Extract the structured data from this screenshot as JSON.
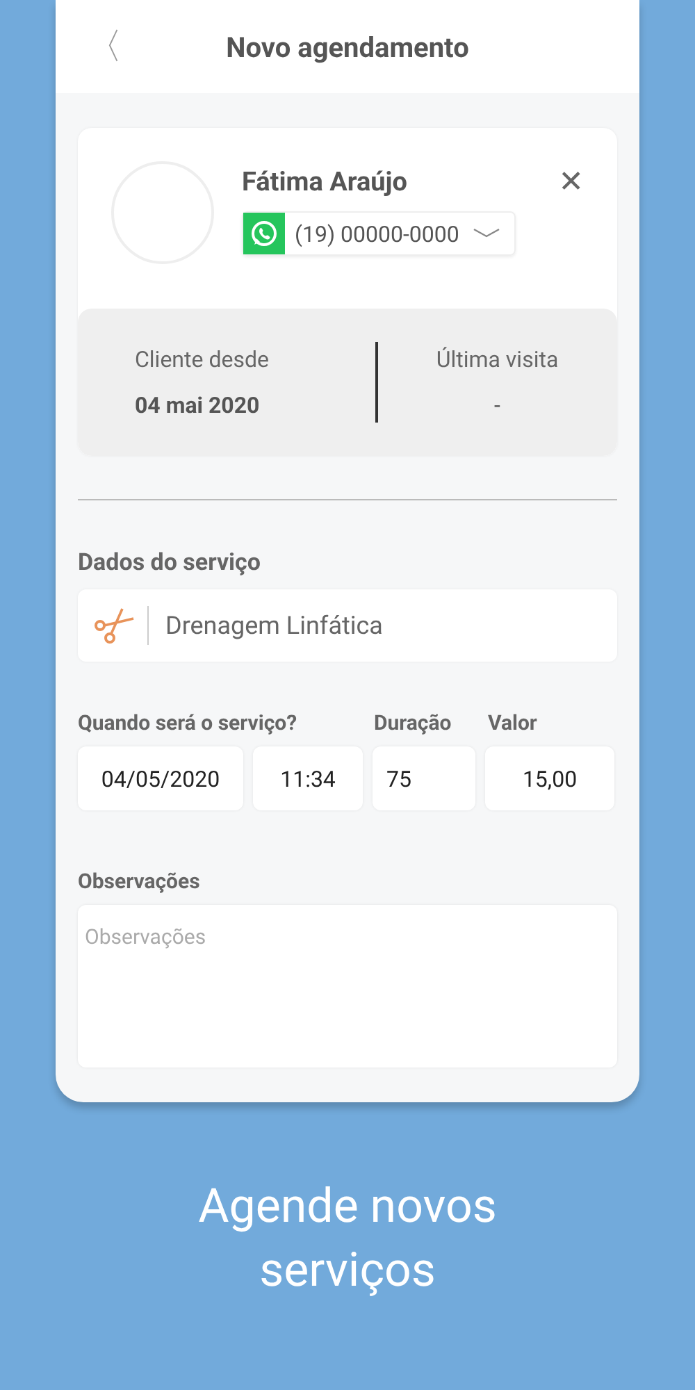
{
  "header": {
    "back": "〈",
    "title": "Novo agendamento"
  },
  "client": {
    "name": "Fátima Araújo",
    "phone": "(19) 00000-0000",
    "close": "✕",
    "stats": [
      {
        "label": "Cliente desde",
        "value": "04 mai 2020"
      },
      {
        "label": "Última visita",
        "value": "-"
      }
    ]
  },
  "service": {
    "heading": "Dados do serviço",
    "value": "Drenagem Linfática"
  },
  "schedule": {
    "labels": [
      "Quando será o serviço?",
      "Duração",
      "Valor"
    ],
    "fields": [
      {
        "kind": "date",
        "value": "04/05/2020"
      },
      {
        "kind": "time",
        "value": "11:34"
      },
      {
        "kind": "duration",
        "value": "75"
      },
      {
        "kind": "price",
        "value": "15,00"
      }
    ]
  },
  "notes": {
    "label": "Observações",
    "placeholder": "Observações"
  },
  "caption": "Agende novos serviços"
}
